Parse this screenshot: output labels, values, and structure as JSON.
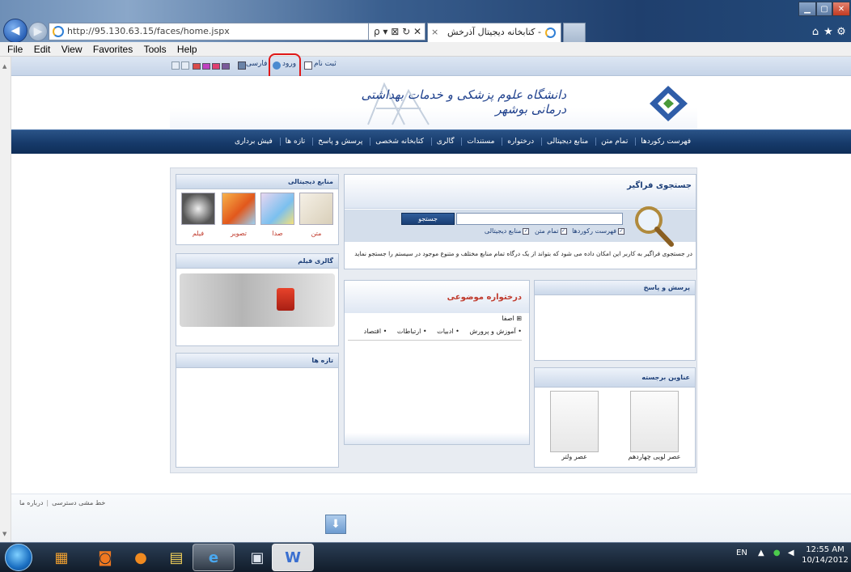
{
  "browser": {
    "address_url": "http://95.130.63.15/faces/home.jspx",
    "address_tools": "ρ ▾ ⊠ ↻ ✕",
    "tab_title": "- کتابخانه دیجیتال آذرخش",
    "tab_close": "×",
    "menu": [
      "File",
      "Edit",
      "View",
      "Favorites",
      "Tools",
      "Help"
    ]
  },
  "site_toolbar": {
    "signup_label": "ثبت نام",
    "login_label": "ورود",
    "language_label": "فارسی"
  },
  "header": {
    "logo_text": "دانشگاه علوم پزشکی و خدمات بهداشتی درمانی بوشهر"
  },
  "nav": {
    "items": [
      "فهرست رکوردها",
      "تمام متن",
      "منابع دیجیتالی",
      "درختواره",
      "مستندات",
      "گالری",
      "کتابخانه شخصی",
      "پرسش و پاسخ",
      "تازه ها",
      "فیش برداری"
    ]
  },
  "digital_resources": {
    "title": "منابع دیجیتالی",
    "items": [
      "متن",
      "صدا",
      "تصویر",
      "فیلم"
    ]
  },
  "film_gallery": {
    "title": "گالری فیلم"
  },
  "news": {
    "title": "تازه ها"
  },
  "search": {
    "title": "جستجوی فراگیر",
    "button": "جستجو",
    "options": [
      "فهرست رکوردها",
      "تمام متن",
      "منابع دیجیتالی"
    ],
    "description": "در جستجوی فراگیر به کاربر این امکان داده می شود که بتواند از یک درگاه تمام منابع مختلف و متنوع موجود در سیستم را جستجو نماید"
  },
  "subject_tree": {
    "title": "درختواره موضوعی",
    "root_toggle": "⊞",
    "root": "اصفا",
    "items": [
      "• آموزش و پرورش",
      "• ادبیات",
      "• ارتباطات",
      "• اقتصاد"
    ]
  },
  "qa": {
    "title": "پرسش و پاسخ"
  },
  "featured": {
    "title": "عناوین برجسته",
    "items": [
      "عصر لویی چهاردهم",
      "عصر ولتر"
    ]
  },
  "footer": {
    "links": [
      "خط مشی دسترسی",
      "درباره ما"
    ]
  },
  "taskbar": {
    "lang": "EN",
    "time": "12:55 AM",
    "date": "10/14/2012"
  },
  "colors": {
    "nav_bar": "#1a3f6e",
    "accent_red": "#c0392b",
    "annotation_ring": "#e01818"
  }
}
